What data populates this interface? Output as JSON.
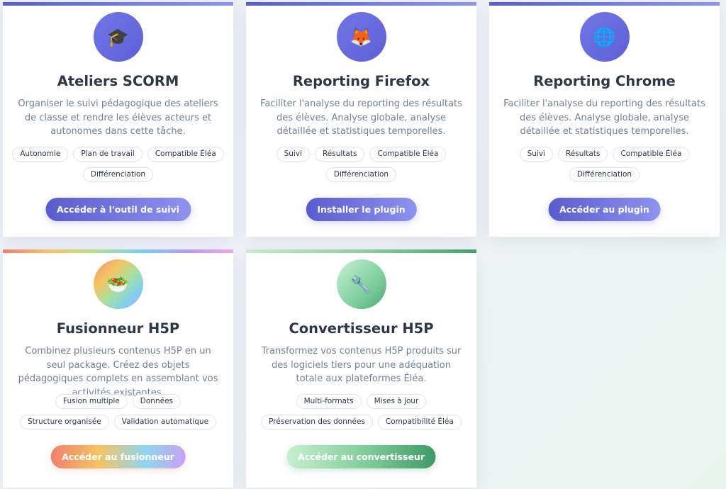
{
  "cards": [
    {
      "icon": "graduation-cap-icon",
      "icon_glyph": "🎓",
      "title": "Ateliers SCORM",
      "description": "Organiser le suivi pédagogique des ateliers de classe et rendre les élèves acteurs et autonomes dans cette tâche.",
      "tags": [
        "Autonomie",
        "Plan de travail",
        "Compatible Éléa",
        "Différenciation"
      ],
      "button": "Accéder à l'outil de suivi",
      "accent": "#5a5fd0"
    },
    {
      "icon": "fox-icon",
      "icon_glyph": "🦊",
      "title": "Reporting Firefox",
      "description": "Faciliter l'analyse du reporting des résultats des élèves. Analyse globale, analyse détaillée et statistiques temporelles.",
      "tags": [
        "Suivi",
        "Résultats",
        "Compatible Éléa",
        "Différenciation"
      ],
      "button": "Installer le plugin",
      "accent": "#5a5fd0"
    },
    {
      "icon": "globe-icon",
      "icon_glyph": "🌐",
      "title": "Reporting Chrome",
      "description": "Faciliter l'analyse du reporting des résultats des élèves. Analyse globale, analyse détaillée et statistiques temporelles.",
      "tags": [
        "Suivi",
        "Résultats",
        "Compatible Éléa",
        "Différenciation"
      ],
      "button": "Accéder au plugin",
      "accent": "#5a5fd0"
    },
    {
      "icon": "bowl-icon",
      "icon_glyph": "🥗",
      "title": "Fusionneur H5P",
      "description": "Combinez plusieurs contenus H5P en un seul package. Créez des objets pédagogiques complets en assemblant vos activités existantes.",
      "tags": [
        "Fusion multiple",
        "Données",
        "Structure organisée",
        "Validation automatique"
      ],
      "button": "Accéder au fusionneur",
      "accent": "#f6c463"
    },
    {
      "icon": "wrench-icon",
      "icon_glyph": "🔧",
      "title": "Convertisseur H5P",
      "description": "Transformez vos contenus H5P produits sur des logiciels tiers pour une adéquation totale aux plateformes Éléa.",
      "tags": [
        "Multi-formats",
        "Mises à jour",
        "Préservation des données",
        "Compatibilité Éléa"
      ],
      "button": "Accéder au convertisseur",
      "accent": "#45a16c"
    }
  ]
}
